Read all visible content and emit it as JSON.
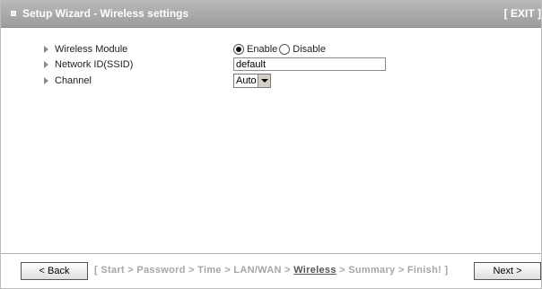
{
  "header": {
    "title": "Setup Wizard - Wireless settings",
    "exit_label": "[ EXIT ]"
  },
  "form": {
    "wireless_module": {
      "label": "Wireless Module",
      "options": [
        "Enable",
        "Disable"
      ],
      "selected": "Enable"
    },
    "ssid": {
      "label": "Network ID(SSID)",
      "value": "default"
    },
    "channel": {
      "label": "Channel",
      "value": "Auto"
    }
  },
  "footer": {
    "back_label": "< Back",
    "next_label": "Next >",
    "steps_open": "[",
    "steps_close": "]",
    "separator": ">",
    "steps": [
      "Start",
      "Password",
      "Time",
      "LAN/WAN",
      "Wireless",
      "Summary",
      "Finish!"
    ],
    "current_step": "Wireless"
  }
}
